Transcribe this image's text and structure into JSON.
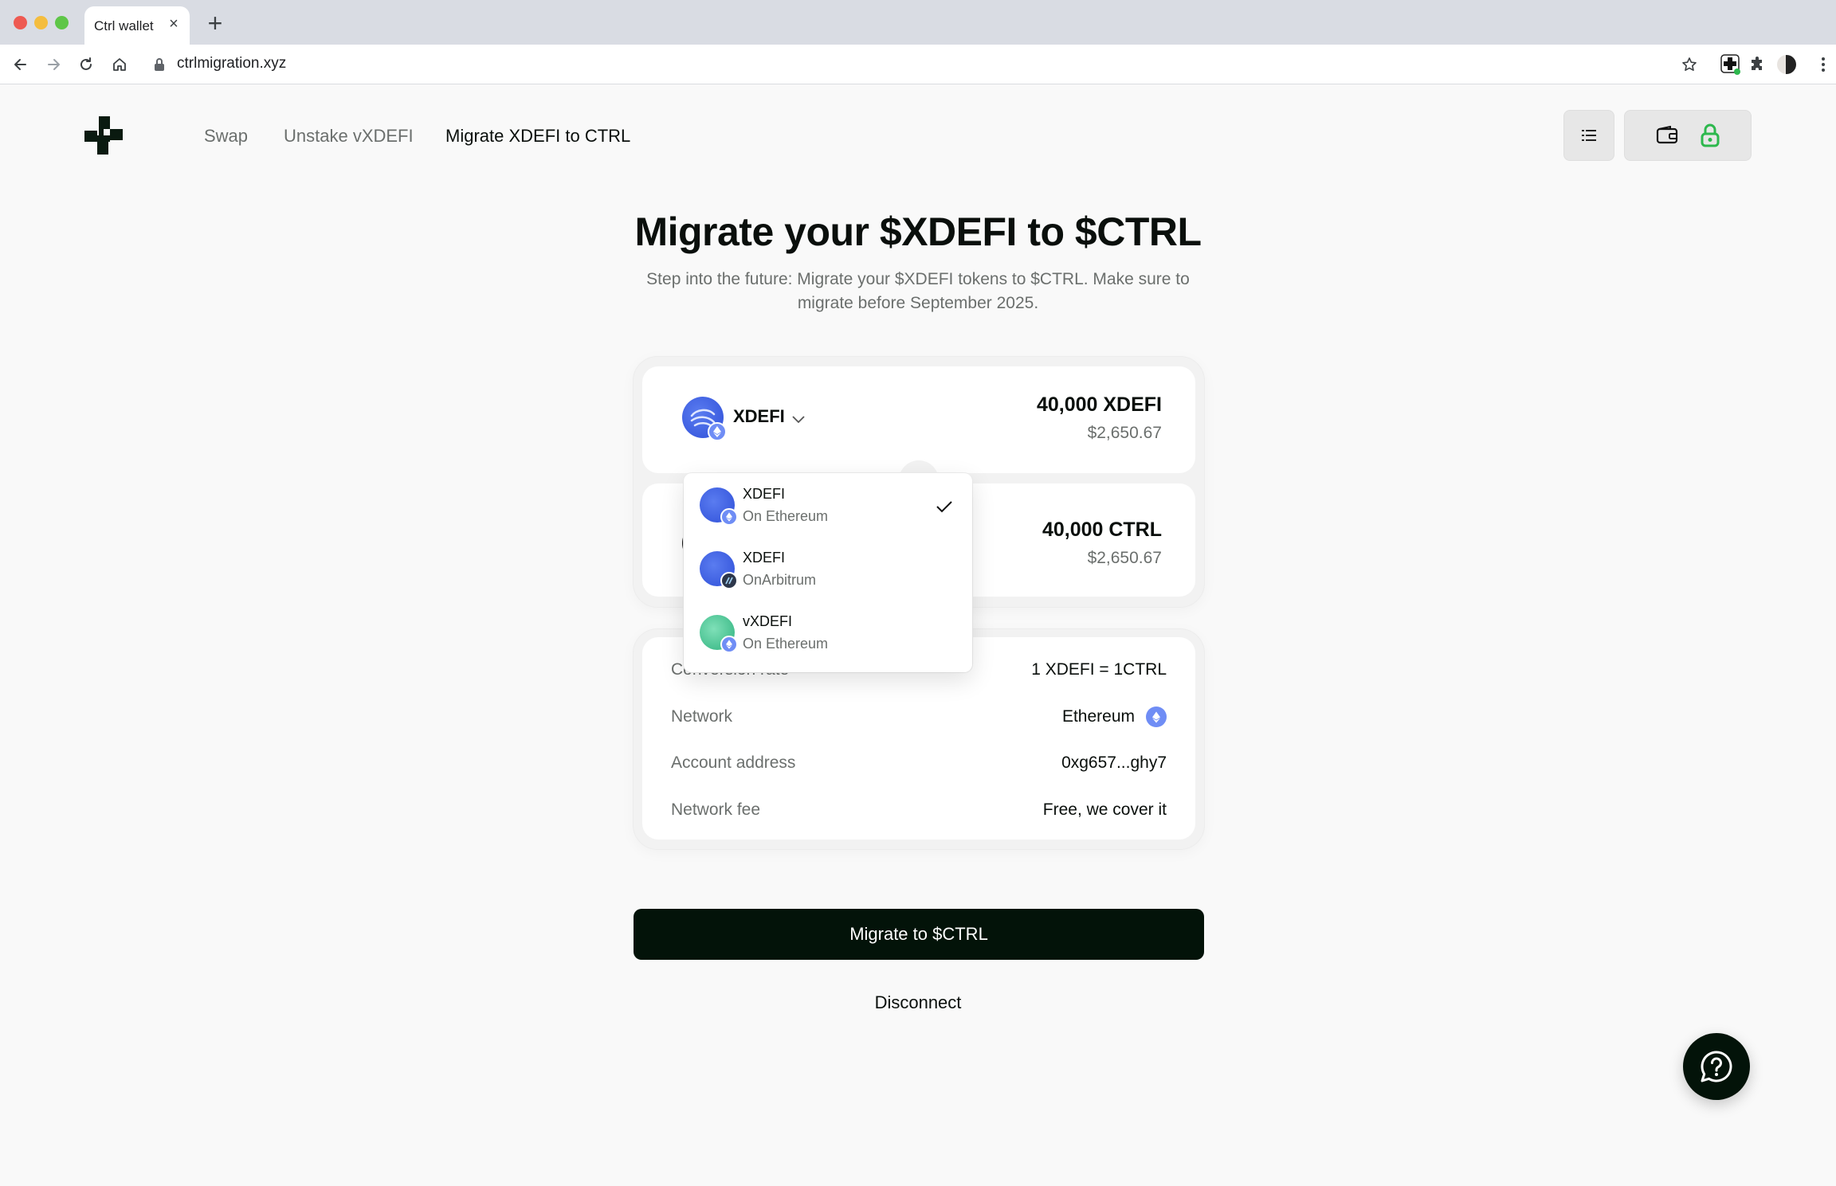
{
  "browser": {
    "tab_title": "Ctrl wallet",
    "tab_close_glyph": "×",
    "new_tab_glyph": "+",
    "url": "ctrlmigration.xyz"
  },
  "nav": {
    "items": [
      {
        "label": "Swap",
        "active": false
      },
      {
        "label": "Unstake vXDEFI",
        "active": false
      },
      {
        "label": "Migrate XDEFI to CTRL",
        "active": true
      }
    ]
  },
  "hero": {
    "title": "Migrate your $XDEFI to $CTRL",
    "subtitle": "Step into the future: Migrate your $XDEFI tokens to $CTRL. Make sure to migrate before September 2025."
  },
  "swap": {
    "from": {
      "token": "XDEFI",
      "amount": "40,000 XDEFI",
      "usd": "$2,650.67",
      "icon": "xdefi-token-icon"
    },
    "to": {
      "amount": "40,000 CTRL",
      "usd": "$2,650.67"
    }
  },
  "dropdown": {
    "items": [
      {
        "name": "XDEFI",
        "network": "On Ethereum",
        "selected": true
      },
      {
        "name": "XDEFI",
        "network": "OnArbitrum",
        "selected": false
      },
      {
        "name": "vXDEFI",
        "network": "On Ethereum",
        "selected": false
      }
    ]
  },
  "info": {
    "rows": [
      {
        "label": "Conversion rate",
        "value": "1 XDEFI = 1CTRL"
      },
      {
        "label": "Network",
        "value": "Ethereum"
      },
      {
        "label": "Account address",
        "value": "0xg657...ghy7"
      },
      {
        "label": "Network fee",
        "value": "Free, we cover it"
      }
    ]
  },
  "actions": {
    "migrate_label": "Migrate to $CTRL",
    "disconnect_label": "Disconnect"
  },
  "colors": {
    "primary": "#031309",
    "accent_green": "#2db84d",
    "token_blue": "#2f4fd8",
    "eth_badge": "#6f8df5"
  }
}
